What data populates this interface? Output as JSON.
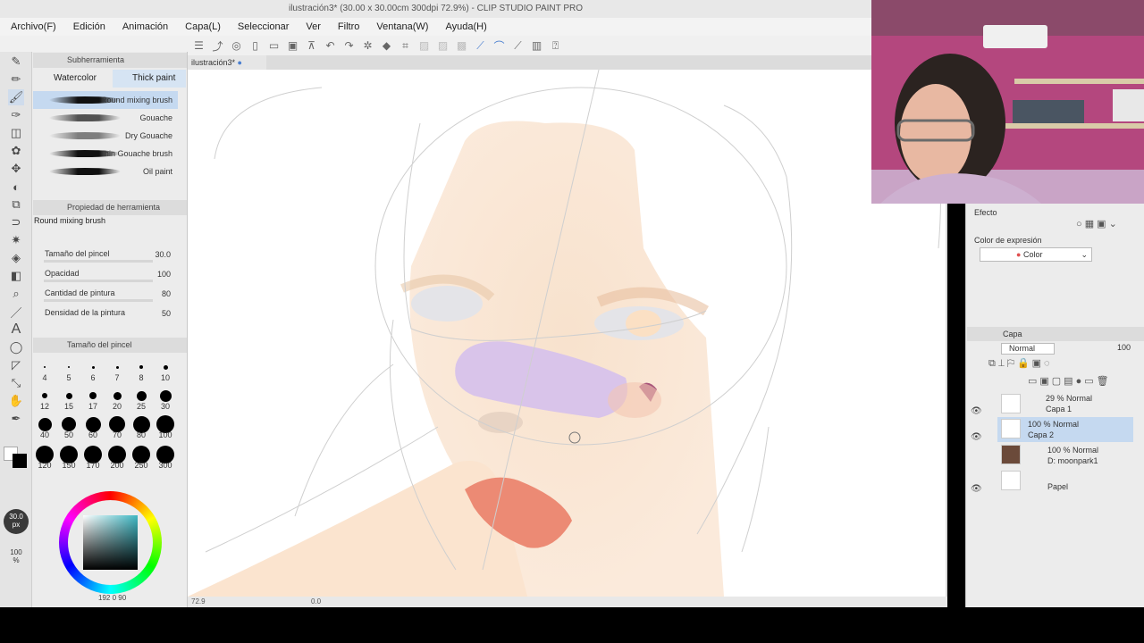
{
  "window": {
    "title": "ilustración3* (30.00 x 30.00cm 300dpi 72.9%) - CLIP STUDIO PAINT PRO"
  },
  "menu": [
    "Archivo(F)",
    "Edición",
    "Animación",
    "Capa(L)",
    "Seleccionar",
    "Ver",
    "Filtro",
    "Ventana(W)",
    "Ayuda(H)"
  ],
  "doc_tab": {
    "label": "ilustración3*"
  },
  "subtool": {
    "header": "Subherramienta",
    "tabs": [
      "Watercolor",
      "Thick paint"
    ],
    "brushes": [
      "Round mixing brush",
      "Gouache",
      "Dry Gouache",
      "Thin Gouache brush",
      "Oil paint"
    ]
  },
  "tool_property": {
    "header": "Propiedad de herramienta",
    "brush_name": "Round mixing brush",
    "rows": [
      {
        "label": "Tamaño del pincel",
        "value": "30.0"
      },
      {
        "label": "Opacidad",
        "value": "100"
      },
      {
        "label": "Cantidad de pintura",
        "value": "80"
      },
      {
        "label": "Densidad de la pintura",
        "value": "50"
      }
    ]
  },
  "brush_size": {
    "header": "Tamaño del pincel",
    "row1": [
      "4",
      "5",
      "6",
      "7",
      "8",
      "10"
    ],
    "row2": [
      "12",
      "15",
      "17",
      "20",
      "25",
      "30"
    ],
    "row3": [
      "40",
      "50",
      "60",
      "70",
      "80",
      "100"
    ],
    "row4": [
      "120",
      "150",
      "170",
      "200",
      "250",
      "300"
    ]
  },
  "left_indicators": {
    "size": "30.0",
    "size_unit": "px",
    "opacity": "100",
    "opacity_unit": "%"
  },
  "color_bottom": {
    "values": "192  0  90"
  },
  "right_panel": {
    "effect_header": "Efecto",
    "expression_label": "Color de expresión",
    "expression_value": "Color",
    "layer_tab": "Capa",
    "blend_mode": "Normal",
    "opacity": "100",
    "layers": [
      {
        "mode": "29 % Normal",
        "name": "Capa 1"
      },
      {
        "mode": "100 % Normal",
        "name": "Capa 2"
      },
      {
        "mode": "100 % Normal",
        "name": "D: moonpark1"
      },
      {
        "mode": "",
        "name": "Papel"
      }
    ]
  },
  "status": {
    "zoom": "72.9",
    "angle": "0.0"
  },
  "colors": {
    "accent": "#4a7fd0",
    "selected_layer": "#c5d9f0",
    "skin": "#f6dcc4",
    "bandage": "#d8c2e8",
    "lips": "#e8806b"
  }
}
